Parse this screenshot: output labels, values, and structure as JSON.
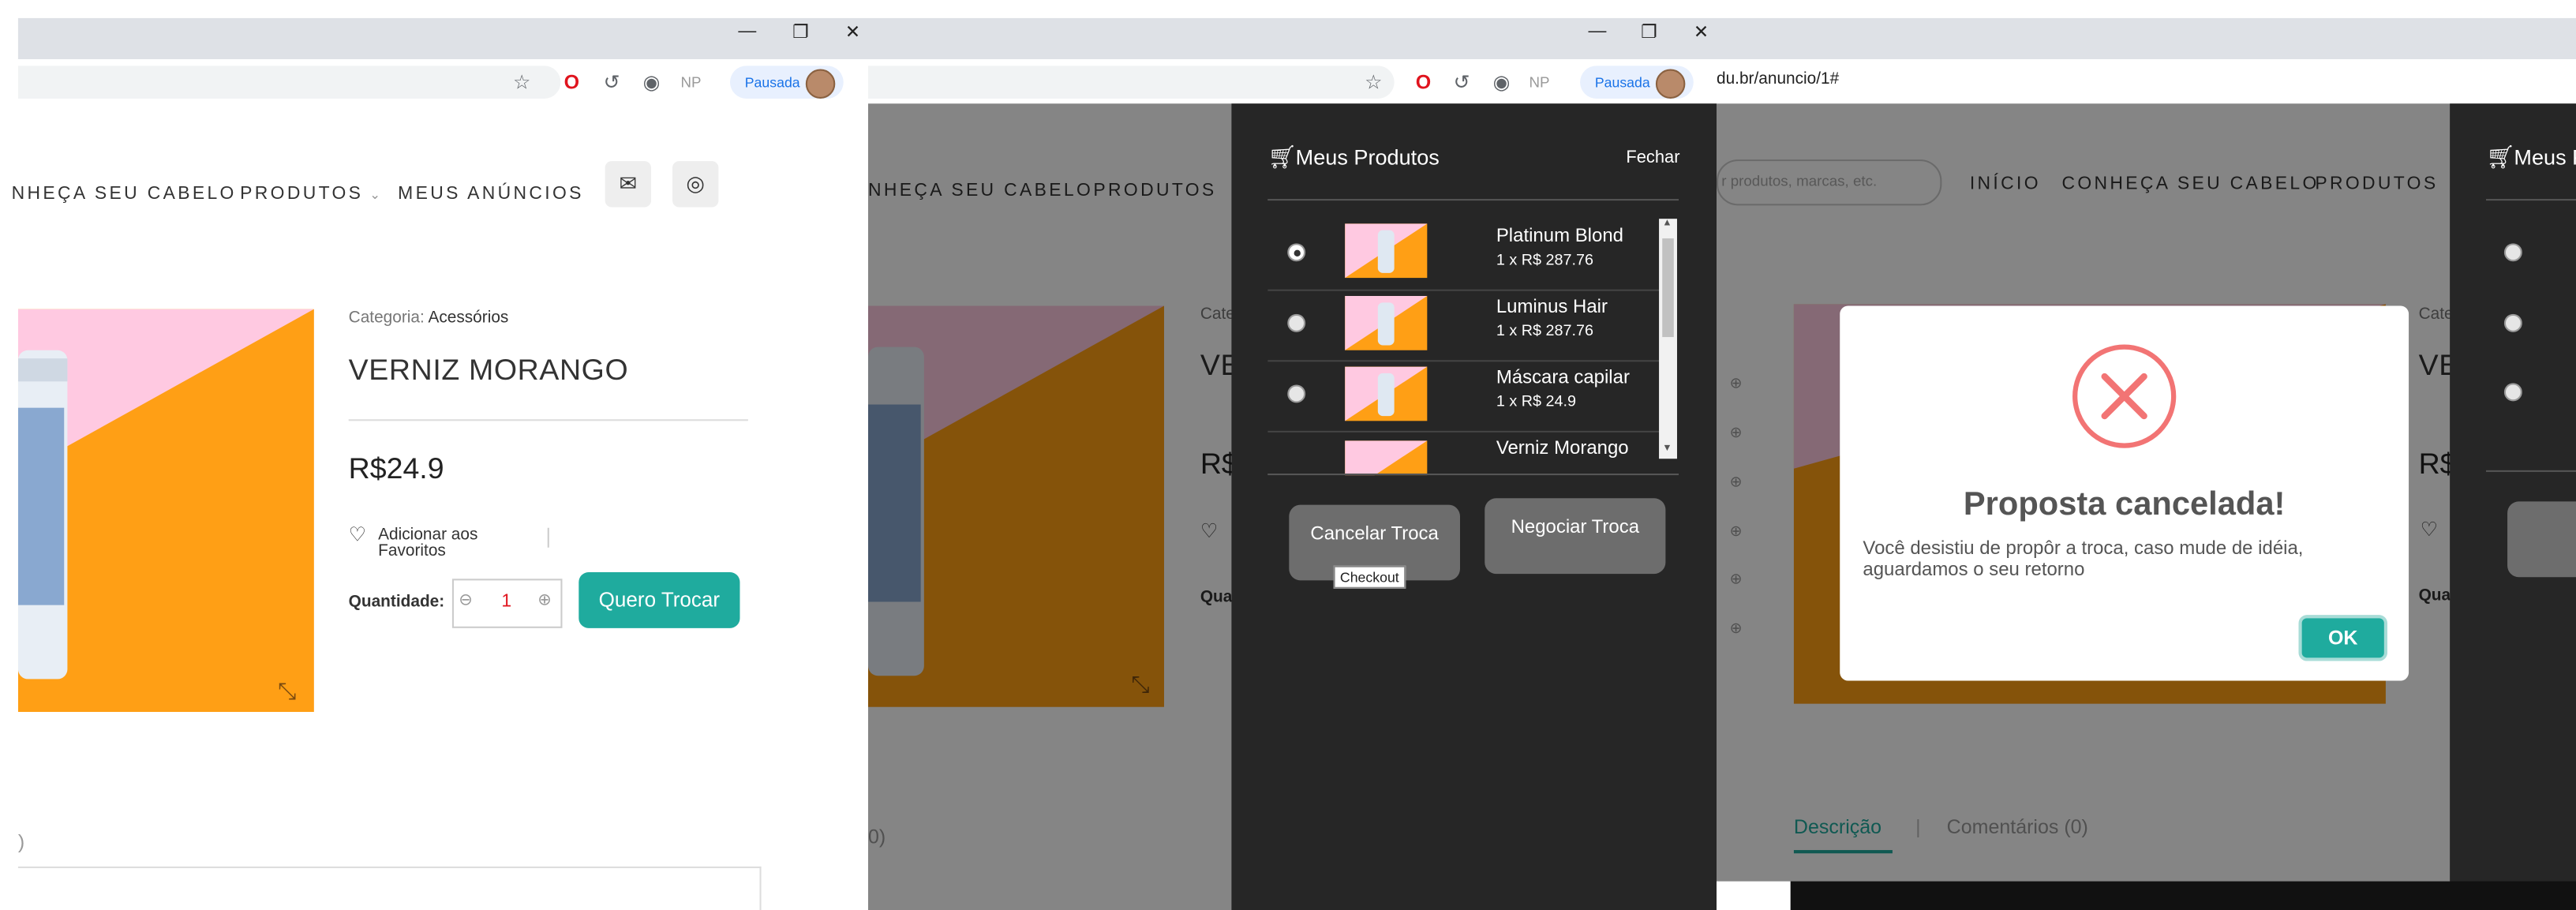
{
  "browser": {
    "pausada_label": "Pausada",
    "ext_np_label": "NP",
    "url_fragment": "du.br/anuncio/1#"
  },
  "nav": {
    "conheca": "NHEÇA SEU CABELO",
    "conheca_full": "CONHEÇA SEU CABELO",
    "produtos": "PRODUTOS",
    "meus_anuncios": "MEUS ANÚNCIOS",
    "inicio": "INÍCIO",
    "search_placeholder": "r produtos, marcas, etc."
  },
  "product": {
    "category_label": "Categoria:",
    "category_value": "Acessórios",
    "title": "VERNIZ MORANGO",
    "price": "R$24.9",
    "favorite_label": "Adicionar aos Favoritos",
    "quantity_label": "Quantidade:",
    "quantity_value": "1",
    "trade_button": "Quero Trocar"
  },
  "panel": {
    "title": "Meus Produtos",
    "close_label": "Fechar",
    "items": [
      {
        "name": "Platinum Blond",
        "detail": "1 x R$ 287.76"
      },
      {
        "name": "Luminus Hair",
        "detail": "1 x R$ 287.76"
      },
      {
        "name": "Máscara capilar",
        "detail": "1 x R$ 24.9"
      },
      {
        "name": "Verniz Morango",
        "detail": ""
      }
    ],
    "cancel_button": "Cancelar Troca",
    "negotiate_button": "Negociar Troca",
    "tooltip": "Checkout"
  },
  "partial": {
    "cate": "Cate",
    "ve": "VE",
    "rs": "R$",
    "qua": "Qua",
    "paren": ")",
    "paren0": "0)"
  },
  "tabs": {
    "descricao": "Descrição",
    "comentarios": "Comentários (0)"
  },
  "modal": {
    "title": "Proposta cancelada!",
    "text": "Você desistiu de propôr a troca, caso mude de idéia, aguardamos o seu retorno",
    "ok": "OK"
  },
  "colors": {
    "teal": "#1fab9e",
    "orange": "#ff9f15",
    "pink": "#ffc9e1",
    "danger": "#f27474",
    "panel": "#262626"
  }
}
